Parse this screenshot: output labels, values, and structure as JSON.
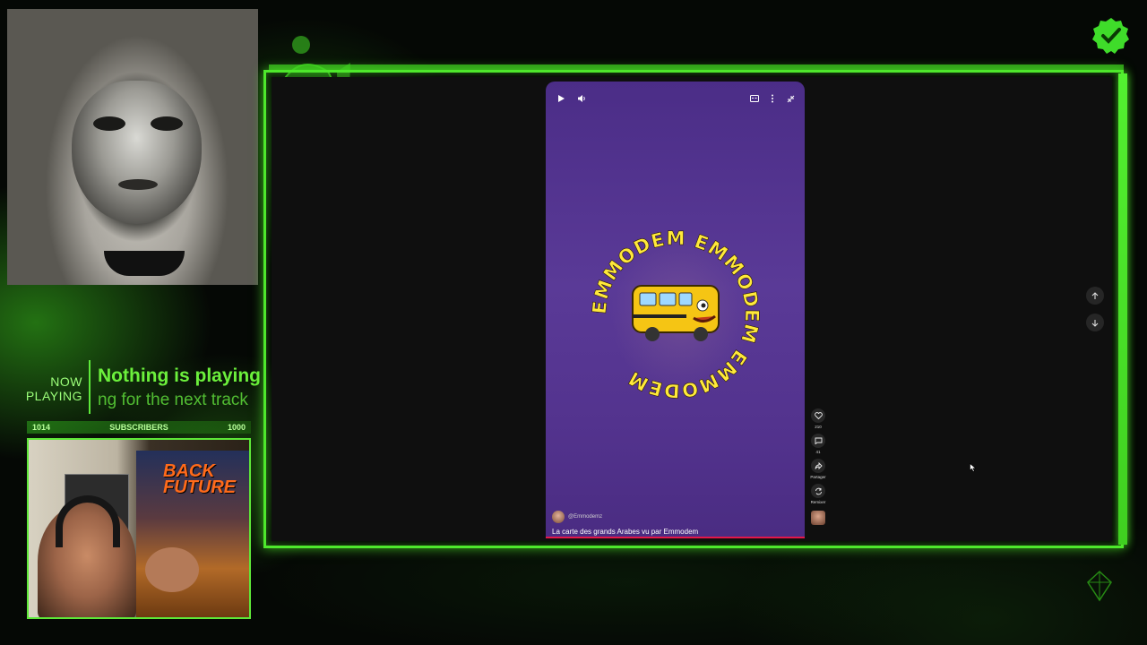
{
  "now_playing": {
    "label_line1": "NOW",
    "label_line2": "PLAYING",
    "title": "Nothing is playing",
    "subtitle": "ng for the next track"
  },
  "subscribers": {
    "current": "1014",
    "label": "SUBSCRIBERS",
    "goal": "1000"
  },
  "webcam_poster": {
    "title_line1": "BACK",
    "title_line2": "FUTURE"
  },
  "video": {
    "emblem_text": "EMMODEM EMMODEM EMMODEM ",
    "channel_handle": "@Emmodemz",
    "title": "La carte des grands Arabes vu par Emmodem",
    "progress": 1.0
  },
  "actions": {
    "likes": "210",
    "comments": "41",
    "share_label": "Partager",
    "remix_label": "Remixer"
  },
  "icons": {
    "play": "play-icon",
    "volume": "volume-icon",
    "captions": "captions-icon",
    "more": "more-vertical-icon",
    "collapse": "collapse-icon",
    "like": "heart-icon",
    "comment": "comment-icon",
    "share": "share-icon",
    "remix": "remix-icon",
    "up": "arrow-up-icon",
    "down": "arrow-down-icon",
    "check": "check-badge-icon"
  },
  "colors": {
    "accent": "#4ee82c",
    "video_bg": "#52338e",
    "emblem_text": "#ffe93a",
    "progress": "#e3174a"
  }
}
